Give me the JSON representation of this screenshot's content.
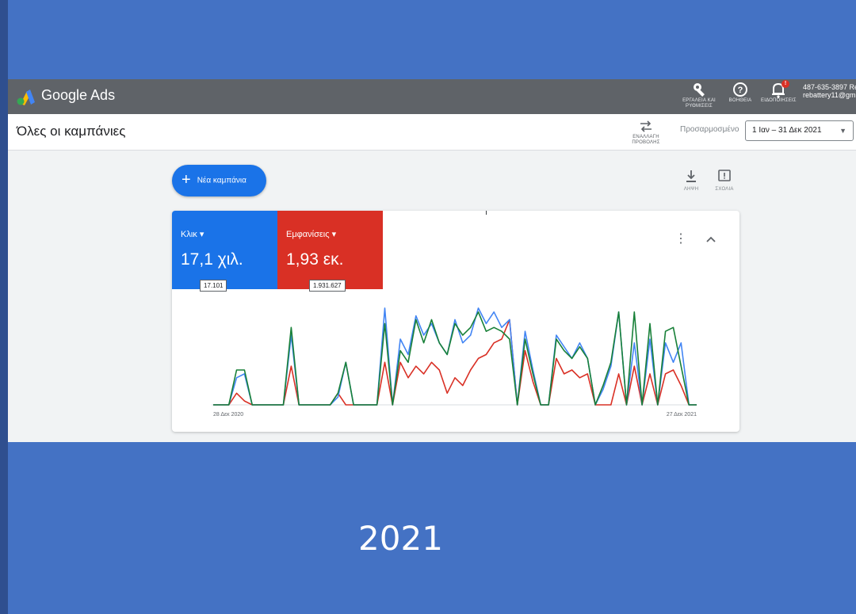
{
  "header": {
    "app_title": "Google Ads",
    "tools": [
      {
        "label": "ΕΡΓΑΛΕΙΑ ΚΑΙ ΡΥΘΜΙΣΕΙΣ",
        "icon": "wrench-icon"
      },
      {
        "label": "ΒΟΗΘΕΙΑ",
        "icon": "help-icon"
      },
      {
        "label": "ΕΙΔΟΠΟΙΗΣΕΙΣ",
        "icon": "bell-icon",
        "badge": "!"
      }
    ],
    "account_id": "487-635-3897 Re",
    "account_email": "rebattery11@gm"
  },
  "subheader": {
    "page_title": "Όλες οι καμπάνιες",
    "switch_view_label": "ΕΝΑΛΛΑΓΗ ΠΡΟΒΟΛΗΣ",
    "date_caption": "Προσαρμοσμένο",
    "date_range": "1 Ιαν – 31 Δεκ 2021"
  },
  "toolbar": {
    "new_campaign": "Νέα καμπάνια",
    "download_label": "ΛΗΨΗ",
    "feedback_label": "ΣΧΟΛΙΑ"
  },
  "metrics": {
    "clicks": {
      "name": "Κλικ",
      "value": "17,1 χιλ.",
      "exact": "17.101"
    },
    "impressions": {
      "name": "Εμφανίσεις",
      "value": "1,93 εκ.",
      "exact": "1.931.627"
    }
  },
  "colors": {
    "clicks": "#4285f4",
    "impressions": "#d93025",
    "conversions": "#188038",
    "topbar": "#5f6368",
    "slide_background": "#4472c4"
  },
  "chart_data": {
    "type": "line",
    "x_start_label": "28 Δεκ 2020",
    "x_end_label": "27 Δεκ 2021",
    "ylim": [
      0,
      130
    ],
    "grid": false,
    "series": [
      {
        "color": "#d93025",
        "values": [
          0,
          0,
          0,
          15,
          5,
          0,
          0,
          0,
          0,
          0,
          50,
          0,
          0,
          0,
          0,
          0,
          15,
          0,
          0,
          0,
          0,
          0,
          55,
          0,
          55,
          35,
          50,
          40,
          55,
          45,
          15,
          35,
          25,
          45,
          60,
          65,
          80,
          85,
          110,
          0,
          70,
          30,
          0,
          0,
          60,
          40,
          45,
          35,
          40,
          0,
          0,
          0,
          40,
          0,
          50,
          0,
          40,
          0,
          40,
          45,
          25,
          0,
          0
        ]
      },
      {
        "color": "#4285f4",
        "values": [
          0,
          0,
          0,
          35,
          40,
          0,
          0,
          0,
          0,
          0,
          90,
          0,
          0,
          0,
          0,
          0,
          10,
          55,
          0,
          0,
          0,
          0,
          125,
          0,
          85,
          65,
          115,
          90,
          105,
          80,
          65,
          110,
          80,
          90,
          125,
          105,
          120,
          100,
          110,
          0,
          95,
          45,
          0,
          0,
          90,
          75,
          60,
          80,
          60,
          0,
          20,
          50,
          120,
          0,
          80,
          0,
          85,
          0,
          80,
          55,
          80,
          0,
          0
        ]
      },
      {
        "color": "#188038",
        "values": [
          0,
          0,
          0,
          45,
          45,
          0,
          0,
          0,
          0,
          0,
          100,
          0,
          0,
          0,
          0,
          0,
          15,
          55,
          0,
          0,
          0,
          0,
          105,
          0,
          70,
          55,
          110,
          80,
          110,
          80,
          65,
          105,
          90,
          100,
          120,
          95,
          100,
          95,
          85,
          0,
          85,
          40,
          0,
          0,
          85,
          70,
          60,
          75,
          60,
          0,
          25,
          55,
          120,
          0,
          120,
          0,
          105,
          0,
          95,
          100,
          50,
          0,
          0
        ]
      }
    ]
  },
  "slide_caption": "2021"
}
